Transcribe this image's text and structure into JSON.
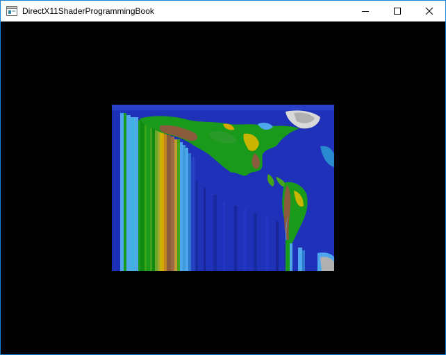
{
  "window": {
    "title": "DirectX11ShaderProgrammingBook",
    "border_color": "#1883d7",
    "background_color": "#000000"
  },
  "titlebar": {
    "buttons": [
      {
        "name": "minimize",
        "icon": "minimize-icon"
      },
      {
        "name": "maximize",
        "icon": "maximize-icon"
      },
      {
        "name": "close",
        "icon": "close-icon"
      }
    ]
  },
  "viewport": {
    "content": "rendered world heightmap texture with stretched/streaked columns",
    "ocean_color": "#1a2fb5",
    "shallow_water_color": "#4ea6ec",
    "lowland_color": "#1a9a1a",
    "highland_color": "#d8c000",
    "mountain_color": "#8a5a3c",
    "ice_color": "#b0b0b0"
  }
}
